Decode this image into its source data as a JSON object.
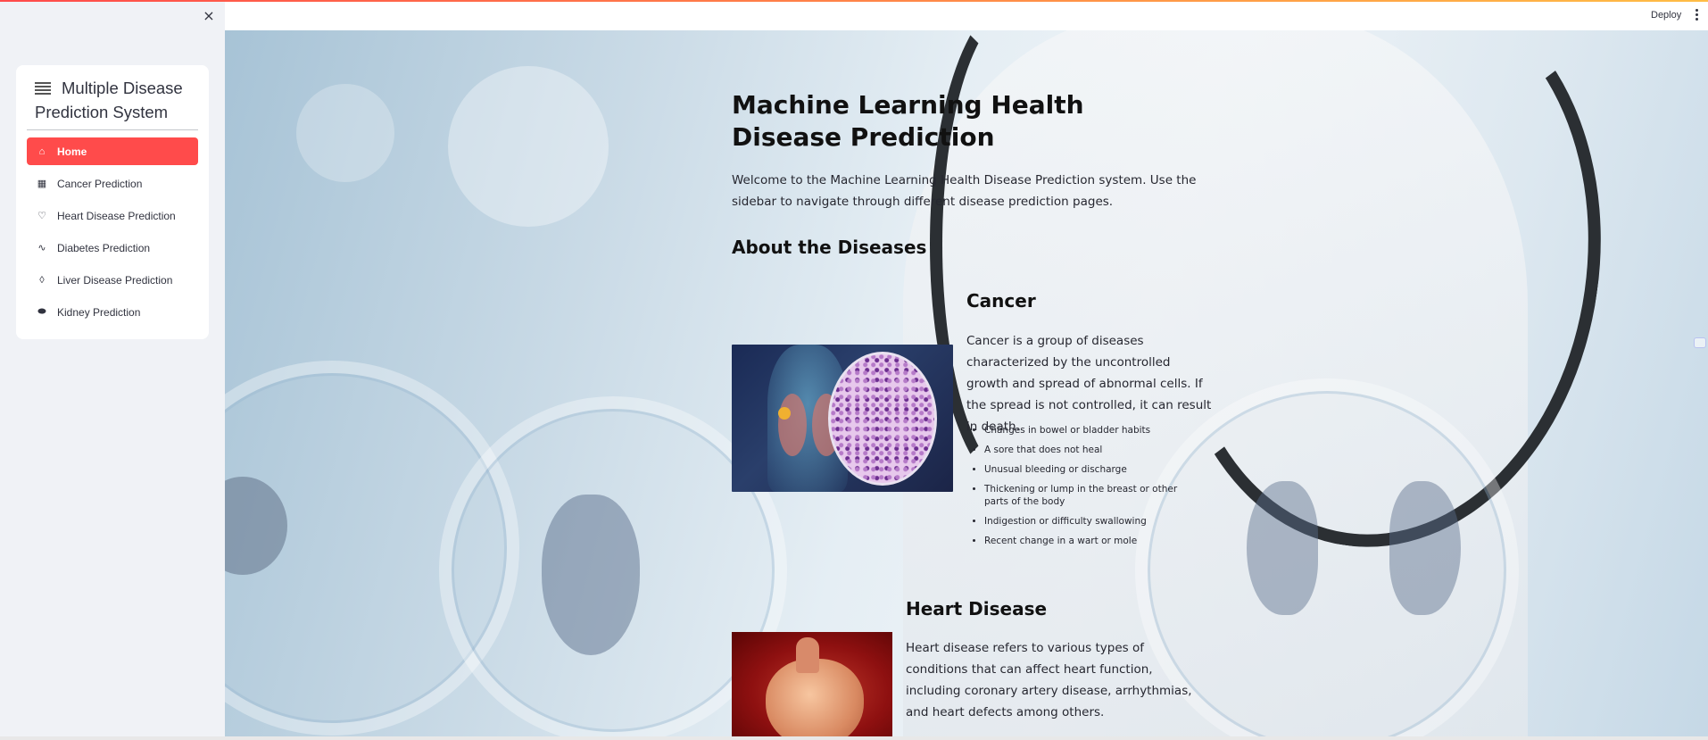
{
  "sidebar": {
    "close_symbol": "×",
    "title": "Multiple Disease Prediction System",
    "items": [
      {
        "label": "Home",
        "icon": "house-icon",
        "glyph": "⌂",
        "active": true
      },
      {
        "label": "Cancer Prediction",
        "icon": "hospital-icon",
        "glyph": "▦"
      },
      {
        "label": "Heart Disease Prediction",
        "icon": "heart-icon",
        "glyph": "♡"
      },
      {
        "label": "Diabetes Prediction",
        "icon": "activity-icon",
        "glyph": "∿"
      },
      {
        "label": "Liver Disease Prediction",
        "icon": "droplet-icon",
        "glyph": "◊"
      },
      {
        "label": "Kidney Prediction",
        "icon": "capsule-icon",
        "glyph": "⬬"
      }
    ]
  },
  "header": {
    "deploy_label": "Deploy"
  },
  "main": {
    "title": "Machine Learning Health Disease Prediction",
    "welcome": "Welcome to the Machine Learning Health Disease Prediction system. Use the sidebar to navigate through different disease prediction pages.",
    "about_heading": "About the Diseases",
    "cancer": {
      "heading": "Cancer",
      "description": "Cancer is a group of diseases characterized by the uncontrolled growth and spread of abnormal cells. If the spread is not controlled, it can result in death.",
      "symptoms": [
        "Changes in bowel or bladder habits",
        "A sore that does not heal",
        "Unusual bleeding or discharge",
        "Thickening or lump in the breast or other parts of the body",
        "Indigestion or difficulty swallowing",
        "Recent change in a wart or mole"
      ]
    },
    "heart": {
      "heading": "Heart Disease",
      "description": "Heart disease refers to various types of conditions that can affect heart function, including coronary artery disease, arrhythmias, and heart defects among others."
    }
  },
  "colors": {
    "accent": "#ff4b4b",
    "sidebar_bg": "#f0f2f6",
    "text": "#31333f"
  }
}
